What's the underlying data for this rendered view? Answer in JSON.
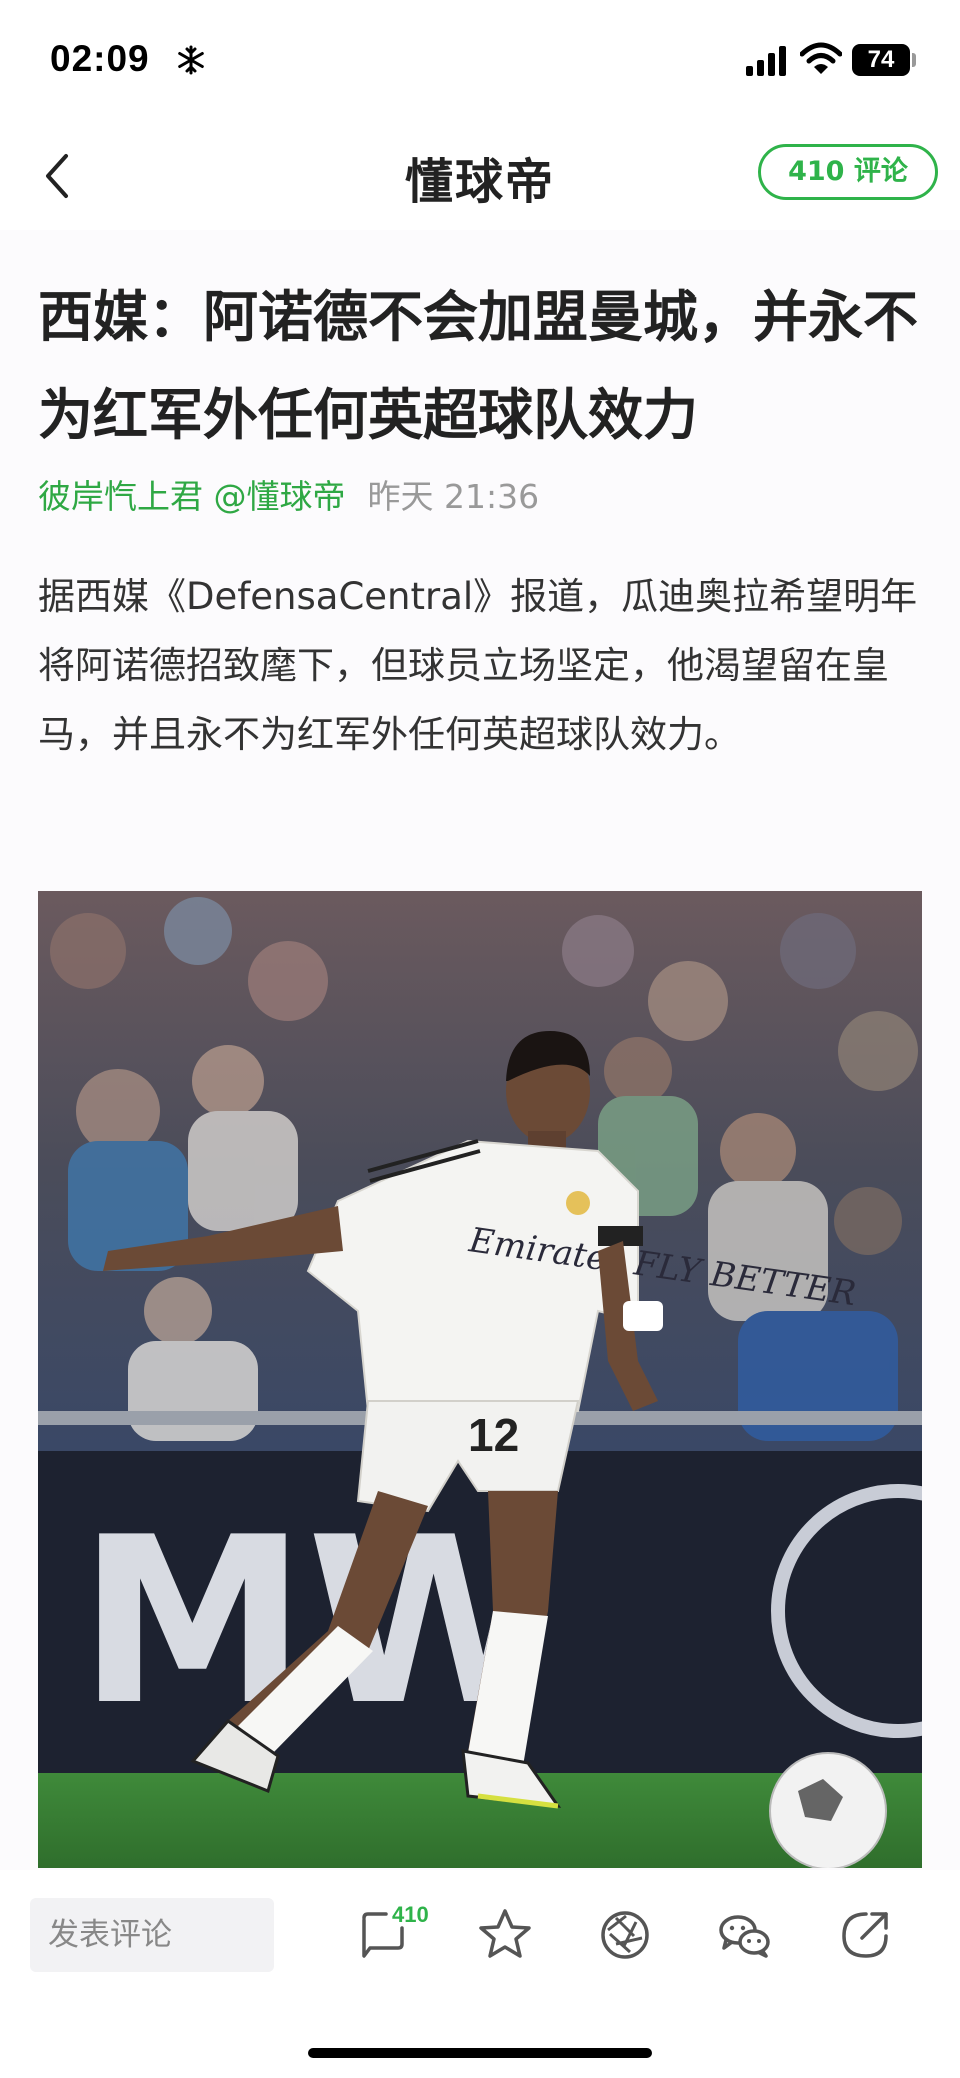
{
  "status_bar": {
    "time": "02:09",
    "battery": "74",
    "icons": [
      "snowflake-icon",
      "signal-icon",
      "wifi-icon",
      "battery-icon"
    ]
  },
  "nav": {
    "back_icon": "chevron-left-icon",
    "title": "懂球帝",
    "comment_button": "410 评论"
  },
  "article": {
    "headline": "西媒：阿诺德不会加盟曼城，并永不为红军外任何英超球队效力",
    "author": "彼岸忾上君 @懂球帝",
    "timestamp": "昨天 21:36",
    "body": "据西媒《DefensaCentral》报道，瓜迪奥拉希望明年将阿诺德招致麾下，但球员立场坚定，他渴望留在皇马，并且永不为红军外任何英超球队效力。",
    "image": {
      "jersey_sponsor": "Emirates FLY BETTER",
      "jersey_number": "12",
      "board_text": "MW"
    }
  },
  "bottom_bar": {
    "comment_placeholder": "发表评论",
    "comment_count": "410",
    "icons": [
      "comment-bubble-icon",
      "star-icon",
      "moments-icon",
      "wechat-icon",
      "share-icon"
    ]
  },
  "colors": {
    "accent_green": "#2fb34a",
    "text_dark": "#222222",
    "text_gray": "#999999"
  }
}
